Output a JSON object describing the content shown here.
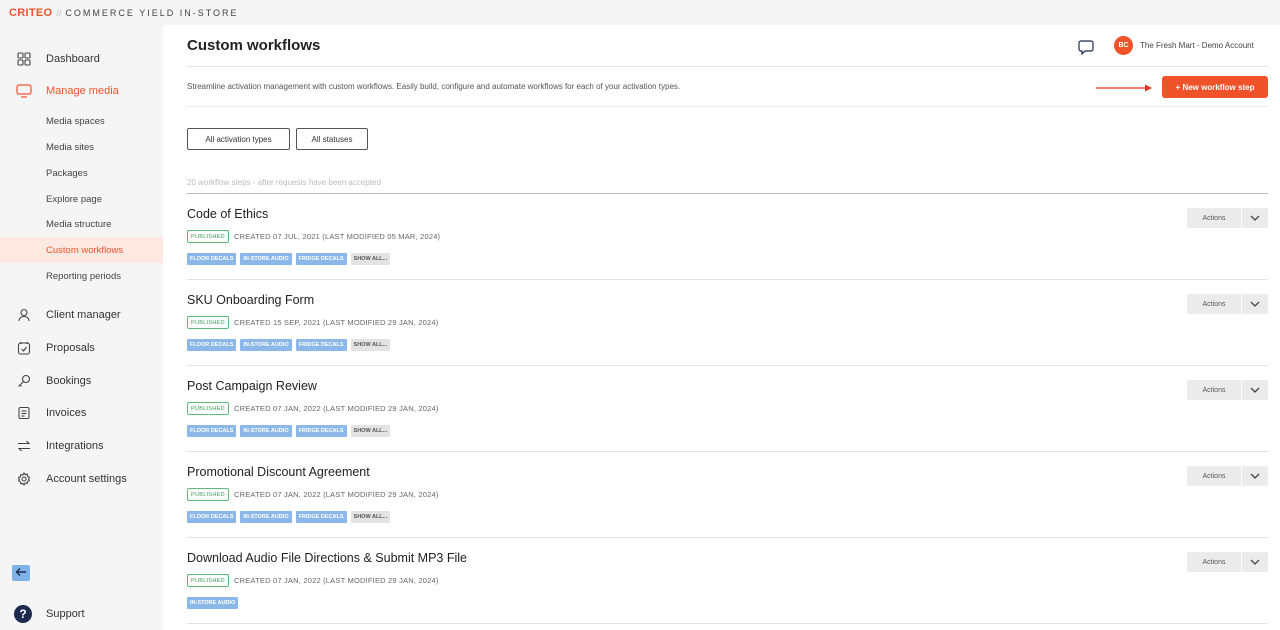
{
  "brand": {
    "logo": "CRITEO",
    "separator": "//",
    "product": "COMMERCE YIELD IN-STORE"
  },
  "sidebar": {
    "items": [
      {
        "label": "Dashboard",
        "icon": "grid-icon"
      },
      {
        "label": "Manage media",
        "icon": "monitor-icon"
      },
      {
        "label": "Client manager",
        "icon": "user-icon"
      },
      {
        "label": "Proposals",
        "icon": "proposal-icon"
      },
      {
        "label": "Bookings",
        "icon": "key-icon"
      },
      {
        "label": "Invoices",
        "icon": "invoice-icon"
      },
      {
        "label": "Integrations",
        "icon": "swap-icon"
      },
      {
        "label": "Account settings",
        "icon": "gear-icon"
      }
    ],
    "media_subitems": [
      "Media spaces",
      "Media sites",
      "Packages",
      "Explore page",
      "Media structure",
      "Custom workflows",
      "Reporting periods"
    ],
    "support": "Support",
    "active_color": "#f0522a"
  },
  "header": {
    "title": "Custom workflows",
    "avatar_initials": "BC",
    "account": "The Fresh Mart - Demo Account"
  },
  "description": "Streamline activation management with custom workflows. Easily build, configure and automate workflows for each of your activation types.",
  "new_button": "+ New workflow step",
  "filters": {
    "types": "All activation types",
    "statuses": "All statuses"
  },
  "count_text": "20 workflow steps - after requests have been accepted",
  "workflows": [
    {
      "title": "Code of Ethics",
      "status": "PUBLISHED",
      "meta": "CREATED 07 JUL, 2021 (LAST MODIFIED 05 MAR, 2024)",
      "tags": [
        "FLOOR DECALS",
        "IN-STORE AUDIO",
        "FRIDGE DECALS"
      ],
      "more": "SHOW ALL...",
      "actions": "Actions"
    },
    {
      "title": "SKU Onboarding Form",
      "status": "PUBLISHED",
      "meta": "CREATED 15 SEP, 2021 (LAST MODIFIED 29 JAN, 2024)",
      "tags": [
        "FLOOR DECALS",
        "IN-STORE AUDIO",
        "FRIDGE DECALS"
      ],
      "more": "SHOW ALL...",
      "actions": "Actions"
    },
    {
      "title": "Post Campaign Review",
      "status": "PUBLISHED",
      "meta": "CREATED 07 JAN, 2022 (LAST MODIFIED 29 JAN, 2024)",
      "tags": [
        "FLOOR DECALS",
        "IN-STORE AUDIO",
        "FRIDGE DECALS"
      ],
      "more": "SHOW ALL...",
      "actions": "Actions"
    },
    {
      "title": "Promotional Discount Agreement",
      "status": "PUBLISHED",
      "meta": "CREATED 07 JAN, 2022 (LAST MODIFIED 29 JAN, 2024)",
      "tags": [
        "FLOOR DECALS",
        "IN-STORE AUDIO",
        "FRIDGE DECALS"
      ],
      "more": "SHOW ALL...",
      "actions": "Actions"
    },
    {
      "title": "Download Audio File Directions & Submit MP3 File",
      "status": "PUBLISHED",
      "meta": "CREATED 07 JAN, 2022 (LAST MODIFIED 29 JAN, 2024)",
      "tags": [
        "IN-STORE AUDIO"
      ],
      "more": "",
      "actions": "Actions"
    }
  ]
}
